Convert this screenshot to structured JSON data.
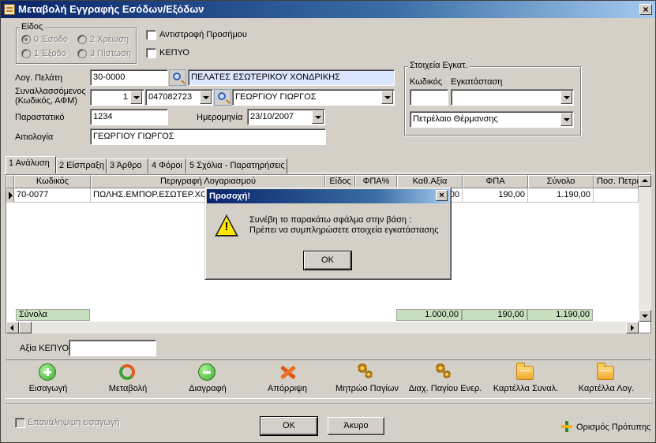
{
  "window": {
    "title": "Μεταβολή Εγγραφής Εσόδων/Εξόδων"
  },
  "type_group": {
    "title": "Είδος",
    "options": [
      "0 Έσοδο",
      "2 Χρέωση",
      "1 Έξοδο",
      "3 Πίστωση"
    ],
    "selected": "0 Έσοδο"
  },
  "checkboxes": {
    "reverse_sign": "Αντιστροφή Προσήμου",
    "kepyo": "ΚΕΠΥΟ"
  },
  "customer": {
    "label": "Λογ. Πελάτη",
    "code": "30-0000",
    "name": "ΠΕΛΑΤΕΣ ΕΣΩΤΕΡΙΚΟΥ ΧΟΝΔΡΙΚΗΣ"
  },
  "counterparty": {
    "label1": "Συναλλασσόμενος",
    "label2": "(Κωδικός, ΑΦΜ)",
    "code": "1",
    "afm": "047082723",
    "name": "ΓΕΩΡΓΙΟΥ ΓΙΩΡΓΟΣ"
  },
  "document": {
    "label": "Παραστατικό",
    "value": "1234"
  },
  "date": {
    "label": "Ημερομηνία",
    "value": "23/10/2007"
  },
  "justification": {
    "label": "Αιτιολογία",
    "value": "ΓΕΩΡΓΙΟΥ ΓΙΩΡΓΟΣ"
  },
  "installation": {
    "title": "Στοιχεία Εγκατ.",
    "code_label": "Κωδικός",
    "inst_label": "Εγκατάσταση",
    "code_value": "",
    "inst_value": "",
    "fuel": "Πετρέλαιο Θέρμανσης"
  },
  "tabs": [
    "1 Ανάλυση",
    "2 Είσπραξη",
    "3 Άρθρο",
    "4 Φόροι",
    "5 Σχόλια - Παρατηρήσεις"
  ],
  "grid": {
    "columns": [
      "Κωδικός",
      "Περιγραφή Λογαριασμού",
      "Είδος",
      "ΦΠΑ%",
      "Καθ.Αξία",
      "ΦΠΑ",
      "Σύνολο",
      "Ποσ. Πετρελ"
    ],
    "rows": [
      {
        "code": "70-0077",
        "desc": "ΠΩΛΗΣ.ΕΜΠΟΡ.ΕΣΩΤΕΡ.ΧΟΝΔ",
        "kind": "",
        "vat_pct": "",
        "net": "1.000,00",
        "vat": "190,00",
        "total": "1.190,00",
        "qty": ""
      }
    ],
    "totals_label": "Σύνολα",
    "totals": {
      "net": "1.000,00",
      "vat": "190,00",
      "total": "1.190,00"
    }
  },
  "kepyo_value": {
    "label": "Αξία ΚΕΠΥΟ",
    "value": ""
  },
  "toolbar": [
    {
      "label": "Εισαγωγή",
      "icon": "add-icon"
    },
    {
      "label": "Μεταβολή",
      "icon": "refresh-icon"
    },
    {
      "label": "Διαγραφή",
      "icon": "delete-icon"
    },
    {
      "label": "Απόρριψη",
      "icon": "discard-icon"
    },
    {
      "label": "Μητρώο Παγίων",
      "icon": "gears-icon"
    },
    {
      "label": "Διαχ. Παγίου Ενερ.",
      "icon": "gears-icon"
    },
    {
      "label": "Καρτέλλα Συναλ.",
      "icon": "folder-icon"
    },
    {
      "label": "Καρτέλλα Λογ.",
      "icon": "folder-icon"
    }
  ],
  "footer": {
    "repeat": "Επανάληψιμη εισαγωγή",
    "ok": "OK",
    "cancel": "Άκυρο",
    "template": "Ορισμός Πρότυπης"
  },
  "dialog": {
    "title": "Προσοχή!",
    "line1": "Συνέβη το παρακάτω σφάλμα στην βάση :",
    "line2": "Πρέπει να συμπληρώσετε στοιχεία εγκατάστασης",
    "ok": "OK"
  }
}
